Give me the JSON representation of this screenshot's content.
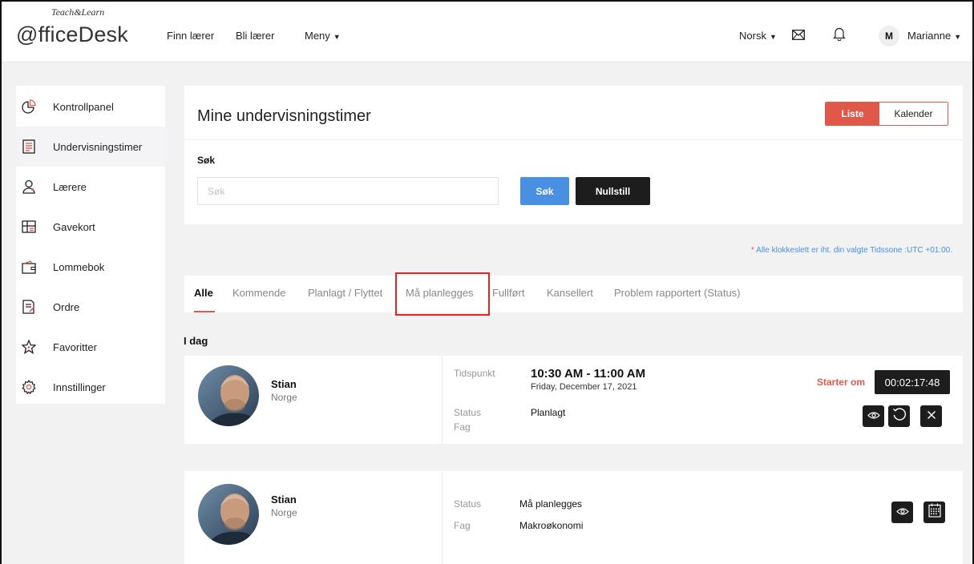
{
  "header": {
    "logo_text": "@fficeDesk",
    "logo_sub": "Teach&Learn",
    "nav": [
      "Finn lærer",
      "Bli lærer",
      "Meny"
    ],
    "language": "Norsk",
    "user_initial": "M",
    "user_name": "Marianne"
  },
  "sidebar": {
    "items": [
      {
        "label": "Kontrollpanel",
        "icon": "pie-chart-icon"
      },
      {
        "label": "Undervisningstimer",
        "icon": "document-icon"
      },
      {
        "label": "Lærere",
        "icon": "user-icon"
      },
      {
        "label": "Gavekort",
        "icon": "gift-card-icon"
      },
      {
        "label": "Lommebok",
        "icon": "wallet-icon"
      },
      {
        "label": "Ordre",
        "icon": "order-icon"
      },
      {
        "label": "Favoritter",
        "icon": "star-icon"
      },
      {
        "label": "Innstillinger",
        "icon": "gear-icon"
      }
    ],
    "active_index": 1
  },
  "main": {
    "title": "Mine undervisningstimer",
    "view_toggle": {
      "list": "Liste",
      "calendar": "Kalender",
      "selected": "Liste"
    },
    "search": {
      "label": "Søk",
      "placeholder": "Søk",
      "value": "",
      "search_button": "Søk",
      "reset_button": "Nullstill"
    },
    "timezone_star": "*",
    "timezone_note": "Alle klokkeslett er iht. din valgte Tidssone :UTC +01:00.",
    "tabs": [
      "Alle",
      "Kommende",
      "Planlagt / Flyttet",
      "Må planlegges",
      "Fullført",
      "Kansellert",
      "Problem rapportert (Status)"
    ],
    "active_tab": "Alle",
    "highlighted_tab": "Må planlegges",
    "section_title": "I dag",
    "lessons": [
      {
        "teacher": "Stian",
        "country": "Norge",
        "time_label": "Tidspunkt",
        "time": "10:30 AM - 11:00 AM",
        "date": "Friday, December 17, 2021",
        "status_label": "Status",
        "status": "Planlagt",
        "subject_label": "Fag",
        "subject": "",
        "starts_label": "Starter om",
        "countdown": "00:02:17:48",
        "actions": [
          "eye-icon",
          "reschedule-icon",
          "close-icon"
        ]
      },
      {
        "teacher": "Stian",
        "country": "Norge",
        "status_label": "Status",
        "status": "Må planlegges",
        "subject_label": "Fag",
        "subject": "Makroøkonomi",
        "actions": [
          "eye-icon",
          "calendar-icon"
        ]
      }
    ]
  },
  "colors": {
    "accent": "#e0584a",
    "primary": "#4a90e2",
    "dark": "#1d1d1d",
    "highlight": "#e0261f"
  }
}
